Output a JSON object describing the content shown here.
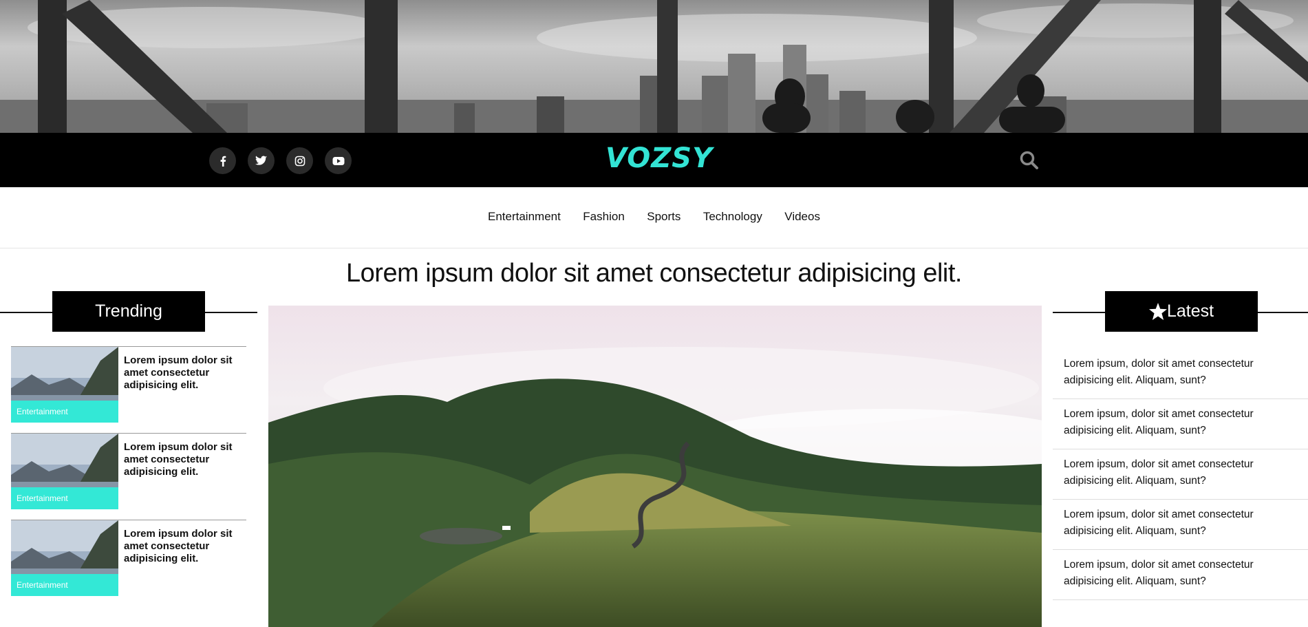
{
  "header": {
    "logo_text": "VOZSY",
    "social_icons": [
      "facebook-icon",
      "twitter-icon",
      "instagram-icon",
      "youtube-icon"
    ],
    "accent_color": "#33e3d4"
  },
  "nav": {
    "items": [
      {
        "label": "Entertainment"
      },
      {
        "label": "Fashion"
      },
      {
        "label": "Sports"
      },
      {
        "label": "Technology"
      },
      {
        "label": "Videos"
      }
    ]
  },
  "main": {
    "headline": "Lorem ipsum dolor sit amet consectetur adipisicing elit."
  },
  "trending": {
    "title": "Trending",
    "items": [
      {
        "text": "Lorem ipsum dolor sit amet consectetur adipisicing elit.",
        "tag": "Entertainment"
      },
      {
        "text": "Lorem ipsum dolor sit amet consectetur adipisicing elit.",
        "tag": "Entertainment"
      },
      {
        "text": "Lorem ipsum dolor sit amet consectetur adipisicing elit.",
        "tag": "Entertainment"
      }
    ]
  },
  "latest": {
    "title": "Latest",
    "icon": "star-icon",
    "items": [
      {
        "text": "Lorem ipsum, dolor sit amet consectetur adipisicing elit. Aliquam, sunt?"
      },
      {
        "text": "Lorem ipsum, dolor sit amet consectetur adipisicing elit. Aliquam, sunt?"
      },
      {
        "text": "Lorem ipsum, dolor sit amet consectetur adipisicing elit. Aliquam, sunt?"
      },
      {
        "text": "Lorem ipsum, dolor sit amet consectetur adipisicing elit. Aliquam, sunt?"
      },
      {
        "text": "Lorem ipsum, dolor sit amet consectetur adipisicing elit. Aliquam, sunt?"
      }
    ]
  }
}
